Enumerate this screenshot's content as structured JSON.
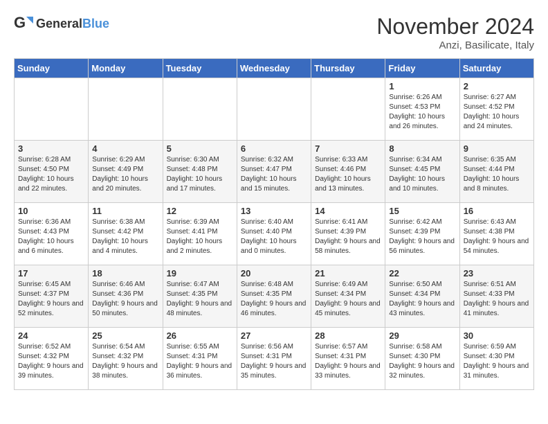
{
  "logo": {
    "general": "General",
    "blue": "Blue"
  },
  "title": "November 2024",
  "location": "Anzi, Basilicate, Italy",
  "headers": [
    "Sunday",
    "Monday",
    "Tuesday",
    "Wednesday",
    "Thursday",
    "Friday",
    "Saturday"
  ],
  "weeks": [
    [
      {
        "day": "",
        "info": ""
      },
      {
        "day": "",
        "info": ""
      },
      {
        "day": "",
        "info": ""
      },
      {
        "day": "",
        "info": ""
      },
      {
        "day": "",
        "info": ""
      },
      {
        "day": "1",
        "info": "Sunrise: 6:26 AM\nSunset: 4:53 PM\nDaylight: 10 hours and 26 minutes."
      },
      {
        "day": "2",
        "info": "Sunrise: 6:27 AM\nSunset: 4:52 PM\nDaylight: 10 hours and 24 minutes."
      }
    ],
    [
      {
        "day": "3",
        "info": "Sunrise: 6:28 AM\nSunset: 4:50 PM\nDaylight: 10 hours and 22 minutes."
      },
      {
        "day": "4",
        "info": "Sunrise: 6:29 AM\nSunset: 4:49 PM\nDaylight: 10 hours and 20 minutes."
      },
      {
        "day": "5",
        "info": "Sunrise: 6:30 AM\nSunset: 4:48 PM\nDaylight: 10 hours and 17 minutes."
      },
      {
        "day": "6",
        "info": "Sunrise: 6:32 AM\nSunset: 4:47 PM\nDaylight: 10 hours and 15 minutes."
      },
      {
        "day": "7",
        "info": "Sunrise: 6:33 AM\nSunset: 4:46 PM\nDaylight: 10 hours and 13 minutes."
      },
      {
        "day": "8",
        "info": "Sunrise: 6:34 AM\nSunset: 4:45 PM\nDaylight: 10 hours and 10 minutes."
      },
      {
        "day": "9",
        "info": "Sunrise: 6:35 AM\nSunset: 4:44 PM\nDaylight: 10 hours and 8 minutes."
      }
    ],
    [
      {
        "day": "10",
        "info": "Sunrise: 6:36 AM\nSunset: 4:43 PM\nDaylight: 10 hours and 6 minutes."
      },
      {
        "day": "11",
        "info": "Sunrise: 6:38 AM\nSunset: 4:42 PM\nDaylight: 10 hours and 4 minutes."
      },
      {
        "day": "12",
        "info": "Sunrise: 6:39 AM\nSunset: 4:41 PM\nDaylight: 10 hours and 2 minutes."
      },
      {
        "day": "13",
        "info": "Sunrise: 6:40 AM\nSunset: 4:40 PM\nDaylight: 10 hours and 0 minutes."
      },
      {
        "day": "14",
        "info": "Sunrise: 6:41 AM\nSunset: 4:39 PM\nDaylight: 9 hours and 58 minutes."
      },
      {
        "day": "15",
        "info": "Sunrise: 6:42 AM\nSunset: 4:39 PM\nDaylight: 9 hours and 56 minutes."
      },
      {
        "day": "16",
        "info": "Sunrise: 6:43 AM\nSunset: 4:38 PM\nDaylight: 9 hours and 54 minutes."
      }
    ],
    [
      {
        "day": "17",
        "info": "Sunrise: 6:45 AM\nSunset: 4:37 PM\nDaylight: 9 hours and 52 minutes."
      },
      {
        "day": "18",
        "info": "Sunrise: 6:46 AM\nSunset: 4:36 PM\nDaylight: 9 hours and 50 minutes."
      },
      {
        "day": "19",
        "info": "Sunrise: 6:47 AM\nSunset: 4:35 PM\nDaylight: 9 hours and 48 minutes."
      },
      {
        "day": "20",
        "info": "Sunrise: 6:48 AM\nSunset: 4:35 PM\nDaylight: 9 hours and 46 minutes."
      },
      {
        "day": "21",
        "info": "Sunrise: 6:49 AM\nSunset: 4:34 PM\nDaylight: 9 hours and 45 minutes."
      },
      {
        "day": "22",
        "info": "Sunrise: 6:50 AM\nSunset: 4:34 PM\nDaylight: 9 hours and 43 minutes."
      },
      {
        "day": "23",
        "info": "Sunrise: 6:51 AM\nSunset: 4:33 PM\nDaylight: 9 hours and 41 minutes."
      }
    ],
    [
      {
        "day": "24",
        "info": "Sunrise: 6:52 AM\nSunset: 4:32 PM\nDaylight: 9 hours and 39 minutes."
      },
      {
        "day": "25",
        "info": "Sunrise: 6:54 AM\nSunset: 4:32 PM\nDaylight: 9 hours and 38 minutes."
      },
      {
        "day": "26",
        "info": "Sunrise: 6:55 AM\nSunset: 4:31 PM\nDaylight: 9 hours and 36 minutes."
      },
      {
        "day": "27",
        "info": "Sunrise: 6:56 AM\nSunset: 4:31 PM\nDaylight: 9 hours and 35 minutes."
      },
      {
        "day": "28",
        "info": "Sunrise: 6:57 AM\nSunset: 4:31 PM\nDaylight: 9 hours and 33 minutes."
      },
      {
        "day": "29",
        "info": "Sunrise: 6:58 AM\nSunset: 4:30 PM\nDaylight: 9 hours and 32 minutes."
      },
      {
        "day": "30",
        "info": "Sunrise: 6:59 AM\nSunset: 4:30 PM\nDaylight: 9 hours and 31 minutes."
      }
    ]
  ]
}
